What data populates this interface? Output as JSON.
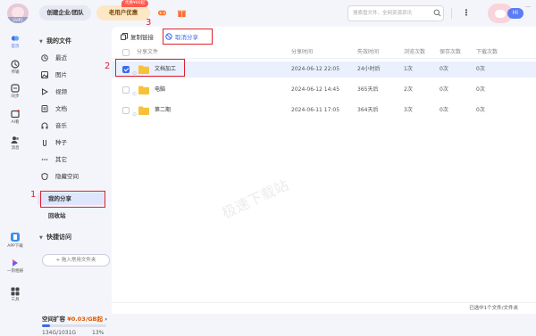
{
  "topbar": {
    "avatar_tag": "SVIP1",
    "enterprise_label": "创建企业/团队",
    "vip_label": "老用户优惠",
    "promo_badge": "优惠¥60起",
    "search_placeholder": "搜索盘文件、全网资源资讯",
    "more_label": "⋮",
    "hi_label": "Hi",
    "window_min": "—"
  },
  "rail": {
    "items": [
      {
        "label": "首页",
        "icon": "home-icon"
      },
      {
        "label": "传输",
        "icon": "transfer-icon"
      },
      {
        "label": "同步",
        "icon": "sync-icon"
      },
      {
        "label": "AI看",
        "icon": "ai-icon"
      },
      {
        "label": "消息",
        "icon": "people-icon"
      },
      {
        "label": "APP下载",
        "icon": "phone-icon"
      },
      {
        "label": "一刻相册",
        "icon": "album-icon"
      },
      {
        "label": "工具",
        "icon": "apps-icon"
      }
    ]
  },
  "sidebar": {
    "my_files_label": "我的文件",
    "items": [
      {
        "label": "最近",
        "icon": "clock-icon"
      },
      {
        "label": "图片",
        "icon": "image-icon"
      },
      {
        "label": "视频",
        "icon": "video-icon"
      },
      {
        "label": "文档",
        "icon": "doc-icon"
      },
      {
        "label": "音乐",
        "icon": "headphone-icon"
      },
      {
        "label": "种子",
        "icon": "seed-icon"
      },
      {
        "label": "其它",
        "icon": "other-icon"
      },
      {
        "label": "隐藏空间",
        "icon": "hidden-icon"
      }
    ],
    "my_share_label": "我的分享",
    "recycle_label": "回收站",
    "quick_access_label": "快捷访问",
    "quick_add_label": "+ 拖入常用文件夹",
    "space_title": "空间扩容",
    "space_promo": "¥0.03/GB起",
    "space_used": "134G/1031G",
    "space_pct": "13%",
    "space_fraction": 0.13
  },
  "toolbar": {
    "copy_link_label": "复制链接",
    "cancel_share_label": "取消分享"
  },
  "table": {
    "headers": [
      "分享文件",
      "分享时间",
      "失效时间",
      "浏览次数",
      "保存次数",
      "下载次数"
    ],
    "rows": [
      {
        "name": "文档加工",
        "time": "2024-06-12 22:05",
        "expire": "24小时后",
        "views": "1次",
        "saves": "0次",
        "downloads": "0次",
        "selected": true
      },
      {
        "name": "电脑",
        "time": "2024-06-12 14:45",
        "expire": "365天后",
        "views": "2次",
        "saves": "0次",
        "downloads": "0次",
        "selected": false
      },
      {
        "name": "第二期",
        "time": "2024-06-11 17:05",
        "expire": "364天后",
        "views": "3次",
        "saves": "0次",
        "downloads": "0次",
        "selected": false
      }
    ]
  },
  "status": {
    "text": "已选中1个文件/文件夹"
  },
  "watermark": "极速下载站",
  "annotations": {
    "one": "1",
    "two": "2",
    "three": "3"
  },
  "colors": {
    "accent": "#3a6bf2",
    "annotation_red": "#e0202a",
    "folder_yellow": "#f7c23a"
  }
}
